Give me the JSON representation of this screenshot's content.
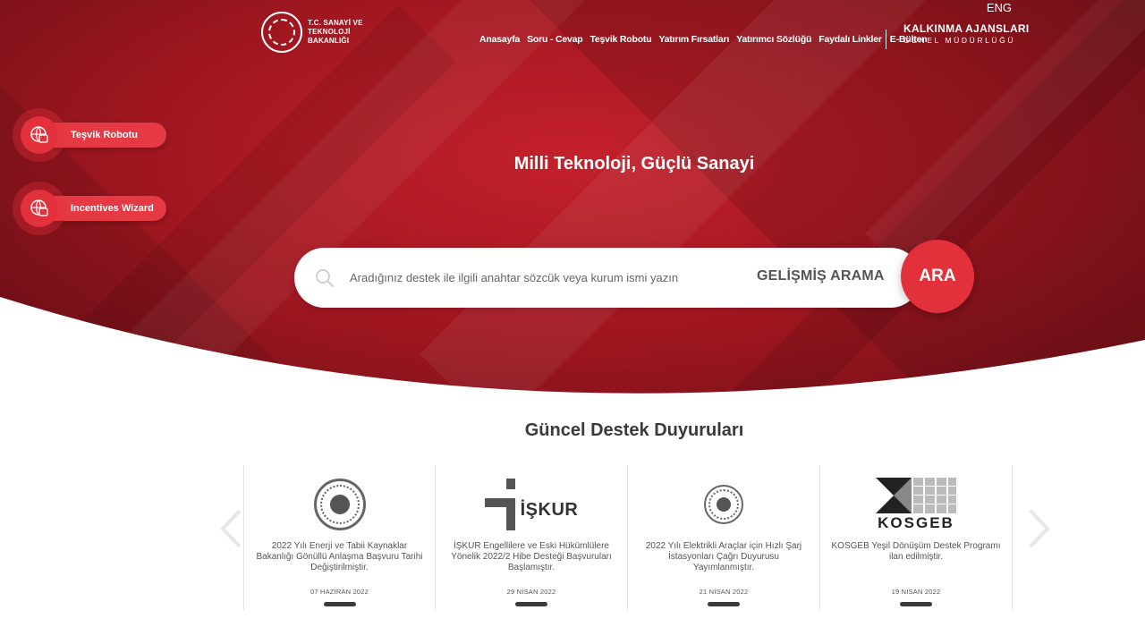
{
  "header": {
    "logo_text": "T.C. SANAYİ VE TEKNOLOJİ BAKANLIĞI",
    "lang": "ENG",
    "nav": [
      "Anasayfa",
      "Soru - Cevap",
      "Teşvik Robotu",
      "Yatırım Fırsatları",
      "Yatırımcı Sözlüğü",
      "Faydalı Linkler"
    ],
    "ebulten": "E-Bülten",
    "agency_title": "KALKINMA AJANSLARI",
    "agency_sub": "GENEL MÜDÜRLÜĞÜ"
  },
  "floating": [
    {
      "label": "Teşvik Robotu",
      "icon": "robot-globe-icon"
    },
    {
      "label": "Incentives Wizard",
      "icon": "robot-globe-icon"
    }
  ],
  "hero": {
    "title": "Milli Teknoloji, Güçlü Sanayi",
    "search_placeholder": "Aradığınız destek ile ilgili anahtar sözcük veya kurum ismi yazın",
    "advanced": "GELİŞMİŞ ARAMA",
    "search_button": "ARA"
  },
  "announcements": {
    "title": "Güncel Destek Duyuruları",
    "items": [
      {
        "logo": "ministry-seal",
        "text": "2022 Yılı Enerji ve Tabii Kaynaklar Bakanlığı Gönüllü Anlaşma Başvuru Tarihi Değiştirilmiştir.",
        "date": "07 HAZİRAN 2022"
      },
      {
        "logo": "iskur",
        "logo_text": "İŞKUR",
        "text": "İŞKUR Engellilere ve Eski Hükümlülere Yönelik 2022/2 Hibe Desteği Başvuruları Başlamıştır.",
        "date": "29 NİSAN 2022"
      },
      {
        "logo": "ministry-seal",
        "text": "2022 Yılı Elektrikli Araçlar için Hızlı Şarj İstasyonları Çağrı Duyurusu Yayımlanmıştır.",
        "date": "21 NİSAN 2022"
      },
      {
        "logo": "kosgeb",
        "logo_text": "KOSGEB",
        "text": "KOSGEB Yeşil Dönüşüm Destek Programı ilan edilmiştir.",
        "date": "19 NİSAN 2022"
      }
    ]
  },
  "colors": {
    "brand_red": "#e3313c",
    "hero_dark": "#9e1620"
  }
}
